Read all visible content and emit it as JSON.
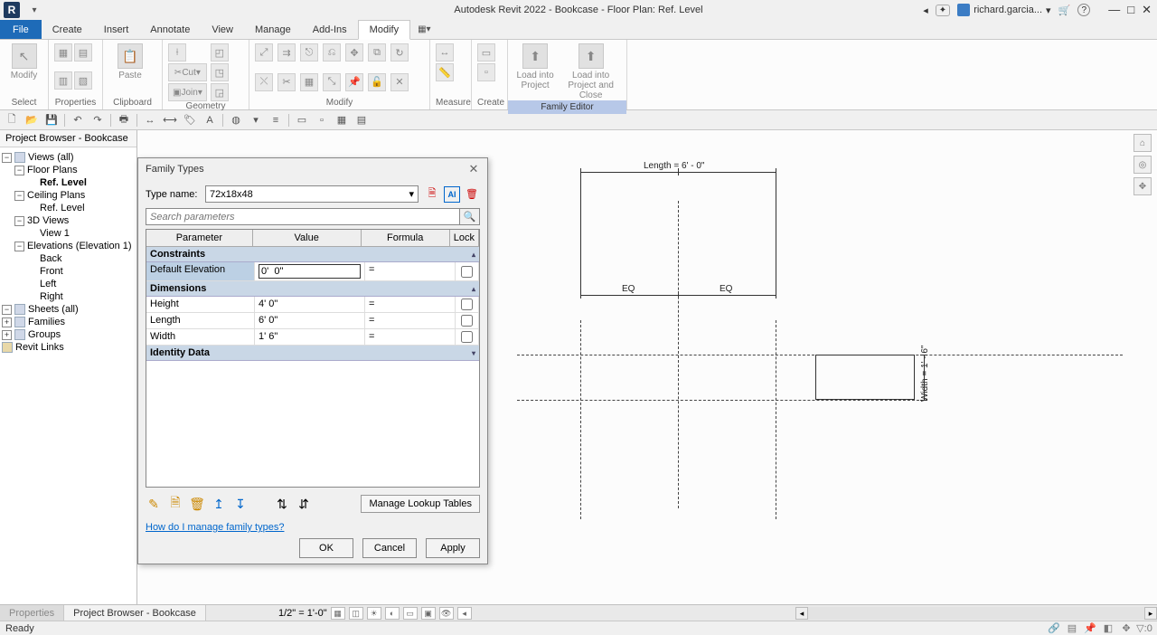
{
  "title": "Autodesk Revit 2022 - Bookcase - Floor Plan: Ref. Level",
  "user_name": "richard.garcia...",
  "menu": {
    "file": "File",
    "items": [
      "Create",
      "Insert",
      "Annotate",
      "View",
      "Manage",
      "Add-Ins",
      "Modify"
    ]
  },
  "ribbon": {
    "select": "Select",
    "modify_big": "Modify",
    "properties": "Properties",
    "clipboard": "Clipboard",
    "paste": "Paste",
    "cut": "Cut",
    "join": "Join",
    "geometry": "Geometry",
    "modify": "Modify",
    "measure": "Measure",
    "create": "Create",
    "family_editor": "Family Editor",
    "load_project": "Load into\nProject",
    "load_close": "Load into\nProject and Close"
  },
  "pb": {
    "title": "Project Browser - Bookcase",
    "views_all": "Views (all)",
    "floor_plans": "Floor Plans",
    "ref_level": "Ref. Level",
    "ceiling_plans": "Ceiling Plans",
    "ref_level2": "Ref. Level",
    "three_d": "3D Views",
    "view1": "View 1",
    "elevations": "Elevations (Elevation 1)",
    "elev": [
      "Back",
      "Front",
      "Left",
      "Right"
    ],
    "sheets": "Sheets (all)",
    "families": "Families",
    "groups": "Groups",
    "links": "Revit Links"
  },
  "dialog": {
    "title": "Family Types",
    "type_label": "Type name:",
    "type_name": "72x18x48",
    "search_placeholder": "Search parameters",
    "columns": [
      "Parameter",
      "Value",
      "Formula",
      "Lock"
    ],
    "section_constraints": "Constraints",
    "section_dimensions": "Dimensions",
    "section_identity": "Identity Data",
    "rows": {
      "de_name": "Default Elevation",
      "de_val": "0'  0\"",
      "de_f": "=",
      "h_name": "Height",
      "h_val": "4'  0\"",
      "h_f": "=",
      "l_name": "Length",
      "l_val": "6'  0\"",
      "l_f": "=",
      "w_name": "Width",
      "w_val": "1'  6\"",
      "w_f": "="
    },
    "manage": "Manage Lookup Tables",
    "help": "How do I manage family types?",
    "ok": "OK",
    "cancel": "Cancel",
    "apply": "Apply"
  },
  "drawing": {
    "length_label": "Length = 6' - 0\"",
    "width_label": "Width = 1' - 6\"",
    "eq": "EQ"
  },
  "bottom": {
    "properties_tab": "Properties",
    "pb_tab": "Project Browser - Bookcase",
    "scale": "1/2\" = 1'-0\""
  },
  "status": {
    "ready": "Ready",
    "filter": ":0"
  }
}
